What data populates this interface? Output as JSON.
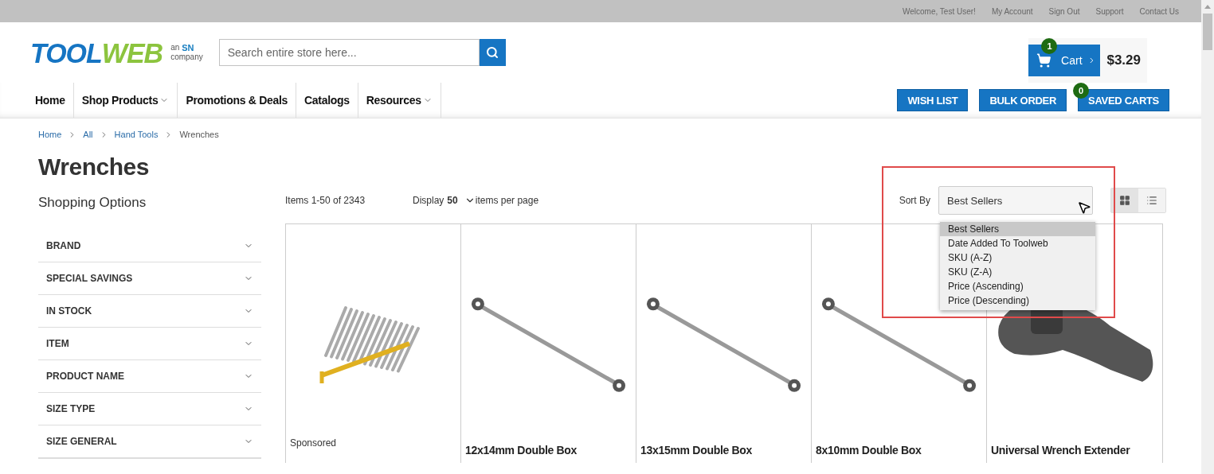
{
  "top_links": [
    "Welcome, Test User!",
    "My Account",
    "Sign Out",
    "Support",
    "Contact Us"
  ],
  "logo": {
    "word_1": "TOOL",
    "word_2": "WEB",
    "tagline_1": "an",
    "tagline_2": "SN",
    "tagline_3": "company"
  },
  "search": {
    "placeholder": "Search entire store here..."
  },
  "cart": {
    "count": "1",
    "label": "Cart",
    "total": "$3.29"
  },
  "nav": [
    {
      "label": "Home",
      "has_menu": false
    },
    {
      "label": "Shop Products",
      "has_menu": true
    },
    {
      "label": "Promotions & Deals",
      "has_menu": false
    },
    {
      "label": "Catalogs",
      "has_menu": false
    },
    {
      "label": "Resources",
      "has_menu": true
    }
  ],
  "action_buttons": [
    {
      "label": "WISH LIST"
    },
    {
      "label": "BULK ORDER"
    },
    {
      "label": "SAVED CARTS",
      "badge": "0"
    }
  ],
  "breadcrumb": [
    {
      "label": "Home",
      "current": false
    },
    {
      "label": "All",
      "current": false
    },
    {
      "label": "Hand Tools",
      "current": false
    },
    {
      "label": "Wrenches",
      "current": true
    }
  ],
  "page_title": "Wrenches",
  "sidebar": {
    "title": "Shopping Options",
    "filters": [
      "BRAND",
      "SPECIAL SAVINGS",
      "IN STOCK",
      "ITEM",
      "PRODUCT NAME",
      "SIZE TYPE",
      "SIZE GENERAL"
    ]
  },
  "toolbar": {
    "count_text": "Items 1-50 of 2343",
    "display_label": "Display",
    "display_value": "50",
    "per_page_label": "items per page",
    "sort_label": "Sort By",
    "sort_value": "Best Sellers",
    "view_modes": [
      {
        "kind": "grid",
        "selected": true
      },
      {
        "kind": "list",
        "selected": false
      }
    ]
  },
  "sort_options": [
    {
      "label": "Best Sellers",
      "selected": true
    },
    {
      "label": "Date Added To Toolweb",
      "selected": false
    },
    {
      "label": "SKU (A-Z)",
      "selected": false
    },
    {
      "label": "SKU (Z-A)",
      "selected": false
    },
    {
      "label": "Price (Ascending)",
      "selected": false
    },
    {
      "label": "Price (Descending)",
      "selected": false
    }
  ],
  "products": [
    {
      "kind": "wrench_set",
      "sponsored": "Sponsored"
    },
    {
      "kind": "wrench",
      "name": "12x14mm Double Box"
    },
    {
      "kind": "wrench",
      "name": "13x15mm Double Box"
    },
    {
      "kind": "wrench",
      "name": "8x10mm Double Box"
    },
    {
      "kind": "extender",
      "name": "Universal Wrench Extender"
    }
  ]
}
